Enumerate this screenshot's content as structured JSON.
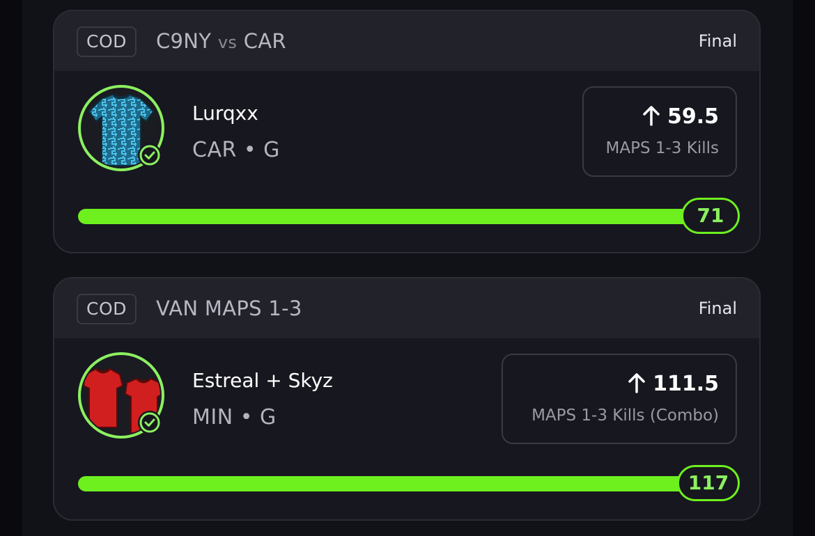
{
  "picks": [
    {
      "league": "COD",
      "match": {
        "team_a": "C9NY",
        "vs": "vs",
        "team_b": "CAR"
      },
      "status": "Final",
      "player": {
        "name": "Lurqxx",
        "team_position": "CAR • G"
      },
      "line": {
        "direction": "up",
        "value": "59.5",
        "stat": "MAPS 1-3 Kills"
      },
      "result": "71",
      "progress_fraction": 1.0,
      "jersey_color": "#2aa0d0"
    },
    {
      "league": "COD",
      "match": {
        "title": "VAN MAPS 1-3"
      },
      "status": "Final",
      "player": {
        "name": "Estreal + Skyz",
        "team_position": "MIN • G"
      },
      "line": {
        "direction": "up",
        "value": "111.5",
        "stat": "MAPS 1-3 Kills (Combo)"
      },
      "result": "117",
      "progress_fraction": 1.0,
      "jersey_color": "#d11f1f"
    }
  ],
  "colors": {
    "accent": "#6ef01f",
    "accent_light": "#8cf060",
    "card": "#17171f",
    "header": "#22222b"
  },
  "icons": [
    "arrow-up-icon",
    "check-circle-icon",
    "jersey-icon"
  ]
}
